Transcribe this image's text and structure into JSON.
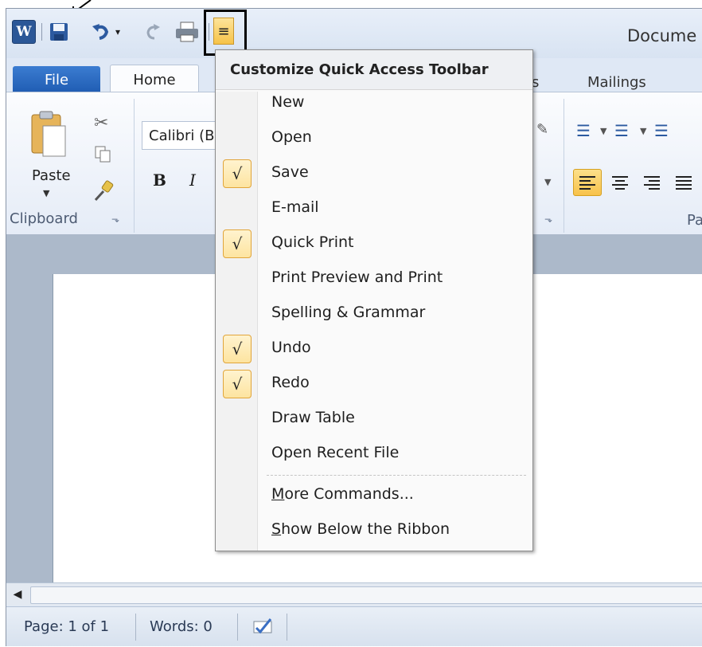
{
  "window": {
    "title": "Docume"
  },
  "quick_access_toolbar": {
    "app_icon": "W",
    "icons": [
      "word-icon",
      "save-icon",
      "undo-icon",
      "redo-icon",
      "quick-print-icon"
    ],
    "dropdown_glyph": "≡"
  },
  "tabs": {
    "file": "File",
    "home": "Home",
    "partial": "s",
    "mailings": "Mailings"
  },
  "ribbon": {
    "clipboard": {
      "paste": "Paste",
      "group_label": "Clipboard"
    },
    "font": {
      "font_name": "Calibri (B",
      "bold": "B",
      "italic": "I"
    },
    "paragraph": {
      "group_label": "Pa"
    }
  },
  "menu": {
    "header": "Customize Quick Access Toolbar",
    "items": [
      {
        "label": "New",
        "checked": false
      },
      {
        "label": "Open",
        "checked": false
      },
      {
        "label": "Save",
        "checked": true
      },
      {
        "label": "E-mail",
        "checked": false
      },
      {
        "label": "Quick Print",
        "checked": true
      },
      {
        "label": "Print Preview and Print",
        "checked": false
      },
      {
        "label": "Spelling & Grammar",
        "checked": false
      },
      {
        "label": "Undo",
        "checked": true
      },
      {
        "label": "Redo",
        "checked": true
      },
      {
        "label": "Draw Table",
        "checked": false
      },
      {
        "label": "Open Recent File",
        "checked": false
      }
    ],
    "more_commands": "More Commands...",
    "show_below": "Show Below the Ribbon",
    "check_glyph": "√"
  },
  "statusbar": {
    "page": "Page: 1 of 1",
    "words": "Words: 0"
  },
  "colors": {
    "accent_yellow": "#f7c24b",
    "file_tab_blue": "#1f5cb2"
  }
}
